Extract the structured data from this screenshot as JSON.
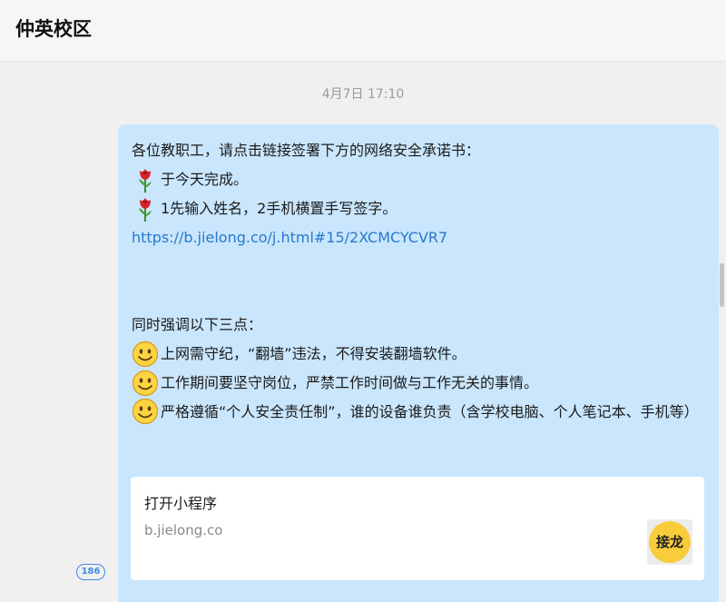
{
  "header": {
    "title": "仲英校区"
  },
  "message": {
    "timestamp": "4月7日 17:10",
    "lines": [
      {
        "icon": "",
        "text": "各位教职工，请点击链接签署下方的网络安全承诺书："
      },
      {
        "icon": "rose",
        "text": "于今天完成。"
      },
      {
        "icon": "rose",
        "text": "1先输入姓名，2手机横置手写签字。"
      },
      {
        "icon": "",
        "text": "https://b.jielong.co/j.html#15/2XCMCYCVR7",
        "link": true
      },
      {
        "icon": "",
        "text": ""
      },
      {
        "icon": "",
        "text": ""
      },
      {
        "icon": "",
        "text": "同时强调以下三点："
      },
      {
        "icon": "smile",
        "text": "上网需守纪，“翻墙”违法，不得安装翻墙软件。"
      },
      {
        "icon": "smile",
        "text": "工作期间要坚守岗位，严禁工作时间做与工作无关的事情。"
      },
      {
        "icon": "smile",
        "text": "严格遵循“个人安全责任制”，谁的设备谁负责（含学校电脑、个人笔记本、手机等）",
        "wrap": true
      }
    ]
  },
  "card": {
    "title": "打开小程序",
    "domain": "b.jielong.co",
    "logo_text": "接龙"
  },
  "unread_badge": "186",
  "colors": {
    "bubble": "#c9e6fd",
    "link": "#2a78cc",
    "badge": "#3f8ae0",
    "logo": "#f8cc3a"
  }
}
